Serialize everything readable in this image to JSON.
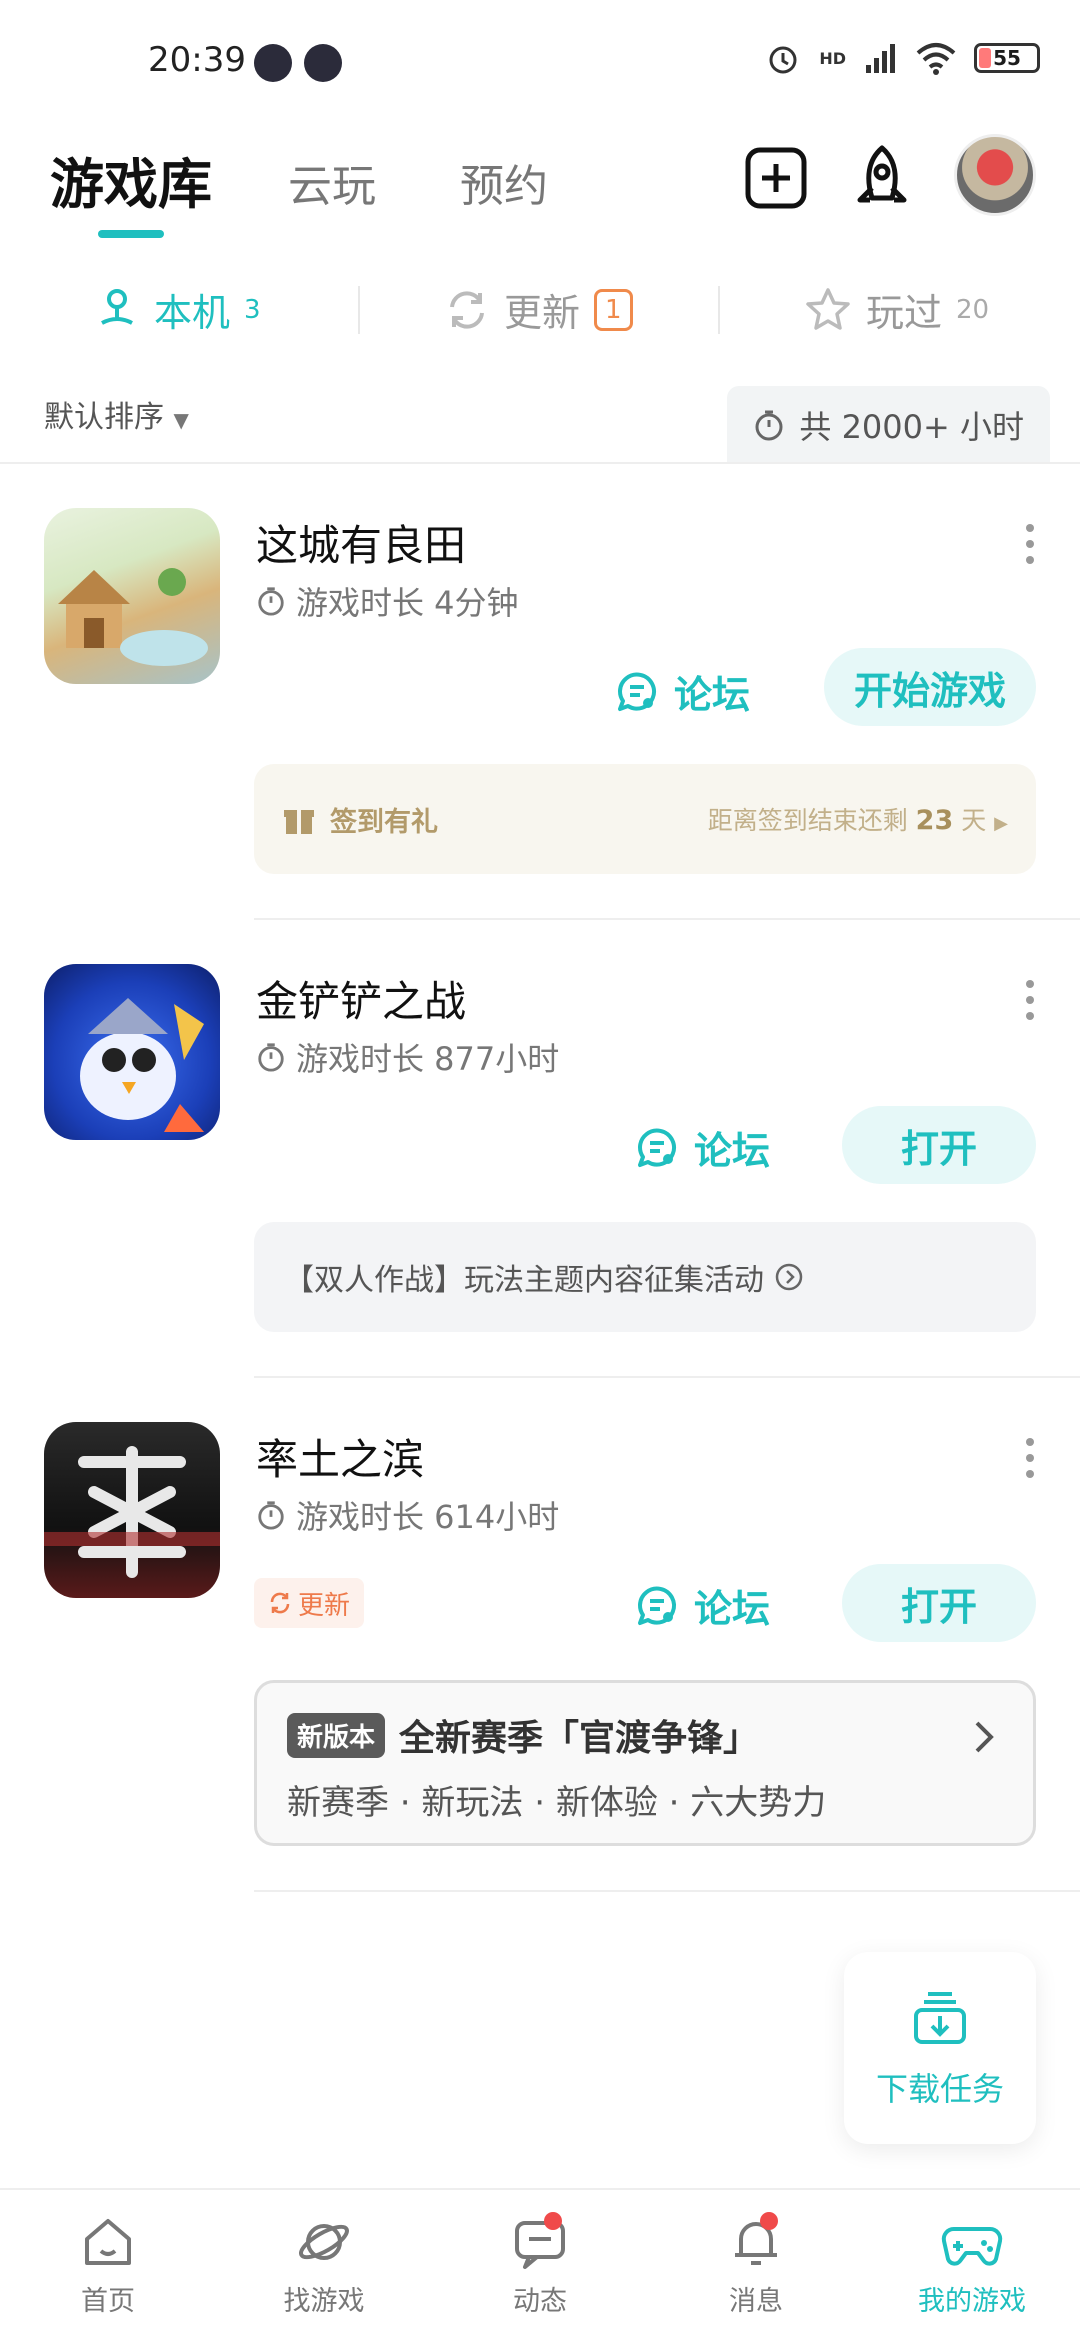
{
  "status_bar": {
    "time": "20:39",
    "battery": "55",
    "network": "HD"
  },
  "header": {
    "tabs": [
      {
        "label": "游戏库"
      },
      {
        "label": "云玩"
      },
      {
        "label": "预约"
      }
    ]
  },
  "subtabs": [
    {
      "label": "本机",
      "count": "3"
    },
    {
      "label": "更新",
      "count": "1"
    },
    {
      "label": "玩过",
      "count": "20"
    }
  ],
  "sort_label": "默认排序",
  "total_time": "共 2000+ 小时",
  "games": [
    {
      "title": "这城有良田",
      "playtime": "游戏时长 4分钟",
      "forum": "论坛",
      "action": "开始游戏",
      "promo": {
        "label": "签到有礼",
        "right_prefix": "距离签到结束还剩",
        "days": "23",
        "unit": "天"
      }
    },
    {
      "title": "金铲铲之战",
      "playtime": "游戏时长 877小时",
      "forum": "论坛",
      "action": "打开",
      "promo": {
        "text": "【双人作战】玩法主题内容征集活动"
      }
    },
    {
      "title": "率土之滨",
      "playtime": "游戏时长 614小时",
      "update_tag": "更新",
      "forum": "论坛",
      "action": "打开",
      "promo": {
        "badge": "新版本",
        "title": "全新赛季「官渡争锋」",
        "subtitle": "新赛季 · 新玩法 · 新体验 · 六大势力"
      }
    }
  ],
  "fab_label": "下载任务",
  "bottom_nav": [
    {
      "label": "首页"
    },
    {
      "label": "找游戏"
    },
    {
      "label": "动态"
    },
    {
      "label": "消息"
    },
    {
      "label": "我的游戏"
    }
  ],
  "colors": {
    "accent": "#1fbfbf",
    "update": "#f08a4b",
    "dot": "#f04a4a"
  }
}
